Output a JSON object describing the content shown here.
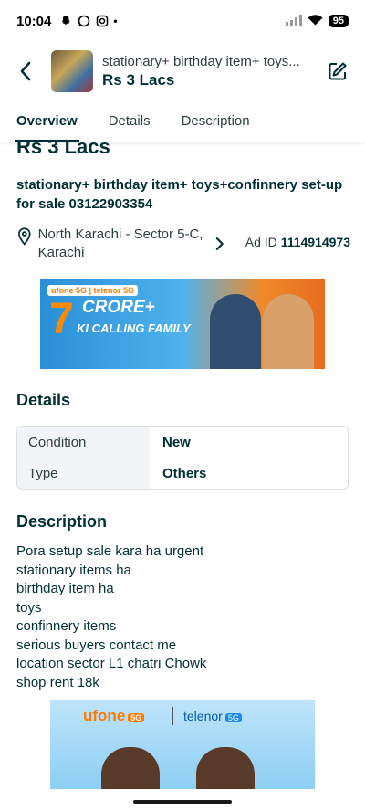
{
  "status_bar": {
    "time": "10:04",
    "battery": "95"
  },
  "header": {
    "title": "stationary+ birthday item+ toys...",
    "price": "Rs 3 Lacs"
  },
  "tabs": [
    {
      "label": "Overview"
    },
    {
      "label": "Details"
    },
    {
      "label": "Description"
    }
  ],
  "ad": {
    "price": "Rs 3 Lacs",
    "title": "stationary+ birthday item+ toys+confinnery set-up for sale 03122903354",
    "location": "North Karachi - Sector 5-C, Karachi",
    "ad_id_label": "Ad ID",
    "ad_id": "1114914973"
  },
  "banner1": {
    "logo": "ufone 5G | telenor 5G",
    "big": "7",
    "headline": "CRORE+",
    "subline": "KI CALLING FAMILY"
  },
  "details": {
    "title": "Details",
    "rows": [
      {
        "key": "Condition",
        "value": "New"
      },
      {
        "key": "Type",
        "value": "Others"
      }
    ]
  },
  "description": {
    "title": "Description",
    "lines": [
      "Pora setup sale kara ha urgent",
      "stationary items ha",
      "birthday item ha",
      "toys",
      "confinnery items",
      "serious buyers contact me",
      "location sector L1 chatri Chowk",
      "shop rent 18k"
    ]
  },
  "banner2": {
    "brand1": "ufone",
    "brand2": "telenor",
    "tag": "5G"
  },
  "colors": {
    "primary": "#002f34",
    "border": "#d8dfe0",
    "key_bg": "#f2f4f5"
  }
}
